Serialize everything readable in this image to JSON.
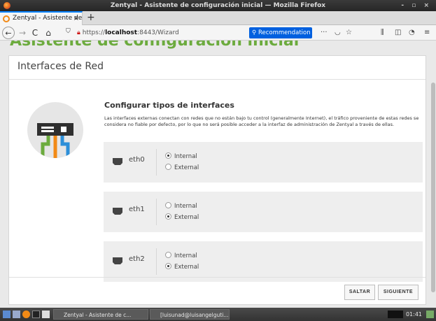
{
  "window": {
    "title": "Zentyal - Asistente de configuración inicial — Mozilla Firefox",
    "controls": "- ▫ ×"
  },
  "browser": {
    "tab_title": "Zentyal - Asistente de c",
    "tab_close": "×",
    "new_tab": "+",
    "url_prefix": "https://",
    "url_host": "localhost",
    "url_rest": ":8443/Wizard",
    "recommendation_label": "Recommendation",
    "more_label": "···",
    "back": "←",
    "forward": "→",
    "reload": "C",
    "home": "⌂"
  },
  "page": {
    "heading": "Asistente de configuración inicial",
    "panel_title": "Interfaces de Red",
    "section_title": "Configurar tipos de interfaces",
    "section_desc": "Las interfaces externas conectan con redes que no están bajo tu control (generalmente Internet), el tráfico proveniente de estas redes se considera no fiable por defecto, por lo que no será posible acceder a la interfaz de administración de Zentyal a través de ellas.",
    "interfaces": [
      {
        "name": "eth0",
        "options": [
          "Internal",
          "External"
        ],
        "selected": "Internal"
      },
      {
        "name": "eth1",
        "options": [
          "Internal",
          "External"
        ],
        "selected": "External"
      },
      {
        "name": "eth2",
        "options": [
          "Internal",
          "External"
        ],
        "selected": "External"
      }
    ],
    "buttons": {
      "skip": "SALTAR",
      "next": "SIGUIENTE"
    }
  },
  "taskbar": {
    "tasks": [
      "Zentyal - Asistente de c...",
      "[luisunad@luisangelguti..."
    ],
    "clock": "01:41"
  },
  "colors": {
    "accent_green": "#6cab3e",
    "firefox_blue": "#0060df",
    "logo_green": "#6cab3e",
    "logo_orange": "#f28a16",
    "logo_blue": "#2d8fd8"
  }
}
